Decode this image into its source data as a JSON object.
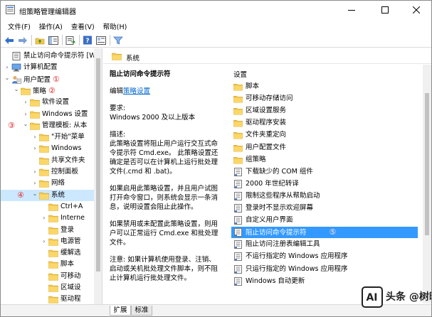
{
  "window": {
    "title": "组策略管理编辑器",
    "controls": {
      "minimize_icon": "minimize-icon",
      "maximize_icon": "maximize-icon",
      "close_icon": "close-icon"
    }
  },
  "menu": [
    "文件(F)",
    "操作(A)",
    "查看(V)",
    "帮助(H)"
  ],
  "toolbar": [
    "back-arrow-icon",
    "forward-arrow-icon",
    "folder-up-icon",
    "show-hide-tree-icon",
    "export-list-icon",
    "help-icon",
    "properties-icon",
    "filter-icon"
  ],
  "tree": [
    {
      "label": "禁止访问命令提示符 [WI",
      "level": 0,
      "arrow": "",
      "icon": "policy-icon"
    },
    {
      "label": "计算机配置",
      "level": 0,
      "arrow": "collapsed",
      "icon": "computer-icon"
    },
    {
      "label": "用户配置",
      "level": 0,
      "arrow": "expanded",
      "icon": "user-icon",
      "marker": "①"
    },
    {
      "label": "策略",
      "level": 1,
      "arrow": "expanded",
      "icon": "folder-icon",
      "marker": "②"
    },
    {
      "label": "软件设置",
      "level": 2,
      "arrow": "collapsed",
      "icon": "folder-icon"
    },
    {
      "label": "Windows 设置",
      "level": 2,
      "arrow": "collapsed",
      "icon": "folder-icon"
    },
    {
      "label": "管理模板: 从本",
      "level": 2,
      "arrow": "expanded",
      "icon": "folder-icon",
      "marker_left": "③"
    },
    {
      "label": "\"开始\"菜单",
      "level": 3,
      "arrow": "collapsed",
      "icon": "folder-icon"
    },
    {
      "label": "Windows",
      "level": 3,
      "arrow": "collapsed",
      "icon": "folder-icon"
    },
    {
      "label": "共享文件夹",
      "level": 3,
      "arrow": "",
      "icon": "folder-icon"
    },
    {
      "label": "控制面板",
      "level": 3,
      "arrow": "collapsed",
      "icon": "folder-icon"
    },
    {
      "label": "网络",
      "level": 3,
      "arrow": "collapsed",
      "icon": "folder-icon"
    },
    {
      "label": "系统",
      "level": 3,
      "arrow": "expanded",
      "icon": "folder-icon",
      "marker_left": "④",
      "selected": true
    },
    {
      "label": "Ctrl+A",
      "level": 4,
      "arrow": "",
      "icon": "folder-icon"
    },
    {
      "label": "Interne",
      "level": 4,
      "arrow": "collapsed",
      "icon": "folder-icon"
    },
    {
      "label": "登录",
      "level": 4,
      "arrow": "",
      "icon": "folder-icon"
    },
    {
      "label": "电源管",
      "level": 4,
      "arrow": "collapsed",
      "icon": "folder-icon"
    },
    {
      "label": "缓解选",
      "level": 4,
      "arrow": "",
      "icon": "folder-icon"
    },
    {
      "label": "脚本",
      "level": 4,
      "arrow": "",
      "icon": "folder-icon"
    },
    {
      "label": "可移动",
      "level": 4,
      "arrow": "",
      "icon": "folder-icon"
    },
    {
      "label": "区域设",
      "level": 4,
      "arrow": "",
      "icon": "folder-icon"
    },
    {
      "label": "驱动程",
      "level": 4,
      "arrow": "",
      "icon": "folder-icon"
    }
  ],
  "right": {
    "header": "系统",
    "description": {
      "title": "阻止访问命令提示符",
      "edit_prefix": "编辑",
      "edit_link": "策略设置",
      "req_label": "要求:",
      "req_value": "Windows 2000 及以上版本",
      "desc_label": "描述:",
      "desc_text": "此策略设置将阻止用户运行交互式命令提示符 Cmd.exe。 此策略设置还确定是否可以在计算机上运行批处理文件(.cmd 和 .bat)。",
      "enabled_text": "如果启用此策略设置，并且用户试图打开命令窗口，则系统会显示一条消息，说明设置会阻止此操作。",
      "disabled_text": "如果禁用或未配置此策略设置，则用户可以正常运行 Cmd.exe 和批处理文件。",
      "note_text": "注意: 如果计算机使用登录、注销、启动或关机批处理文件脚本，则不阻止计算机运行批处理文件。"
    },
    "settings_header": "设置",
    "settings": [
      {
        "label": "脚本",
        "icon": "folder-icon"
      },
      {
        "label": "可移动存储访问",
        "icon": "folder-icon"
      },
      {
        "label": "区域设置服务",
        "icon": "folder-icon"
      },
      {
        "label": "驱动程序安装",
        "icon": "folder-icon"
      },
      {
        "label": "文件夹重定向",
        "icon": "folder-icon"
      },
      {
        "label": "用户配置文件",
        "icon": "folder-icon"
      },
      {
        "label": "组策略",
        "icon": "folder-icon"
      },
      {
        "label": "下载缺少的 COM 组件",
        "icon": "policy-setting-icon"
      },
      {
        "label": "2000 年世纪转译",
        "icon": "policy-setting-icon"
      },
      {
        "label": "限制这些程序从帮助启动",
        "icon": "policy-setting-icon"
      },
      {
        "label": "登录时不显示欢迎屏幕",
        "icon": "policy-setting-icon"
      },
      {
        "label": "自定义用户界面",
        "icon": "policy-setting-icon"
      },
      {
        "label": "阻止访问命令提示符",
        "icon": "policy-setting-icon",
        "selected": true,
        "marker": "⑤"
      },
      {
        "label": "阻止访问注册表编辑工具",
        "icon": "policy-setting-icon"
      },
      {
        "label": "不运行指定的 Windows 应用程序",
        "icon": "policy-setting-icon"
      },
      {
        "label": "只运行指定的 Windows 应用程序",
        "icon": "policy-setting-icon"
      },
      {
        "label": "Windows 自动更新",
        "icon": "policy-setting-icon"
      }
    ]
  },
  "tabs": [
    "扩展",
    "标准"
  ],
  "watermark": {
    "badge": "AI",
    "text": "头条 @树时"
  },
  "colors": {
    "selection": "#3399ff",
    "tree_selection": "#cce8ff",
    "folder": "#f4c74a",
    "marker": "#e02020",
    "link": "#0066cc"
  }
}
